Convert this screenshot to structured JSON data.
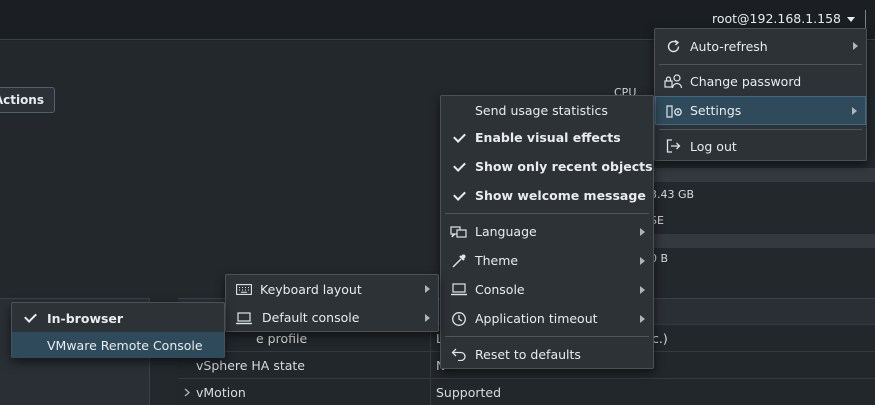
{
  "header": {
    "user": "root@192.168.1.158"
  },
  "toolbar": {
    "actions_label": "Actions"
  },
  "summary": {
    "cpu_label": "CPU",
    "memory_value": "3.43 GB",
    "memory_suffix": "SE",
    "storage_value": "0 B"
  },
  "table": {
    "rows": [
      {
        "label": "e profile",
        "value": "L",
        "value_right": "c.)"
      },
      {
        "label": "vSphere HA state",
        "value": "N"
      },
      {
        "label": "vMotion",
        "value": "Supported"
      }
    ]
  },
  "user_menu": {
    "items": [
      {
        "label": "Auto-refresh",
        "icon": "refresh-icon",
        "submenu": true
      },
      {
        "label": "Change password",
        "icon": "lock-user-icon",
        "submenu": false
      },
      {
        "label": "Settings",
        "icon": "user-gear-icon",
        "submenu": true,
        "highlighted": true
      },
      {
        "label": "Log out",
        "icon": "logout-icon",
        "submenu": false
      }
    ]
  },
  "settings_menu": {
    "toggles": [
      {
        "label": "Send usage statistics",
        "checked": false
      },
      {
        "label": "Enable visual effects",
        "checked": true
      },
      {
        "label": "Show only recent objects",
        "checked": true
      },
      {
        "label": "Show welcome message",
        "checked": true
      }
    ],
    "submenus": [
      {
        "label": "Language",
        "icon": "language-icon"
      },
      {
        "label": "Theme",
        "icon": "eyedropper-icon"
      },
      {
        "label": "Console",
        "icon": "laptop-icon"
      },
      {
        "label": "Application timeout",
        "icon": "clock-icon"
      }
    ],
    "reset_label": "Reset to defaults"
  },
  "console_menu": {
    "items": [
      {
        "label": "Keyboard layout",
        "icon": "keyboard-icon"
      },
      {
        "label": "Default console",
        "icon": "laptop-icon"
      }
    ]
  },
  "default_console_menu": {
    "items": [
      {
        "label": "In-browser",
        "checked": true
      },
      {
        "label": "VMware Remote Console",
        "checked": false,
        "highlighted": true
      }
    ]
  }
}
